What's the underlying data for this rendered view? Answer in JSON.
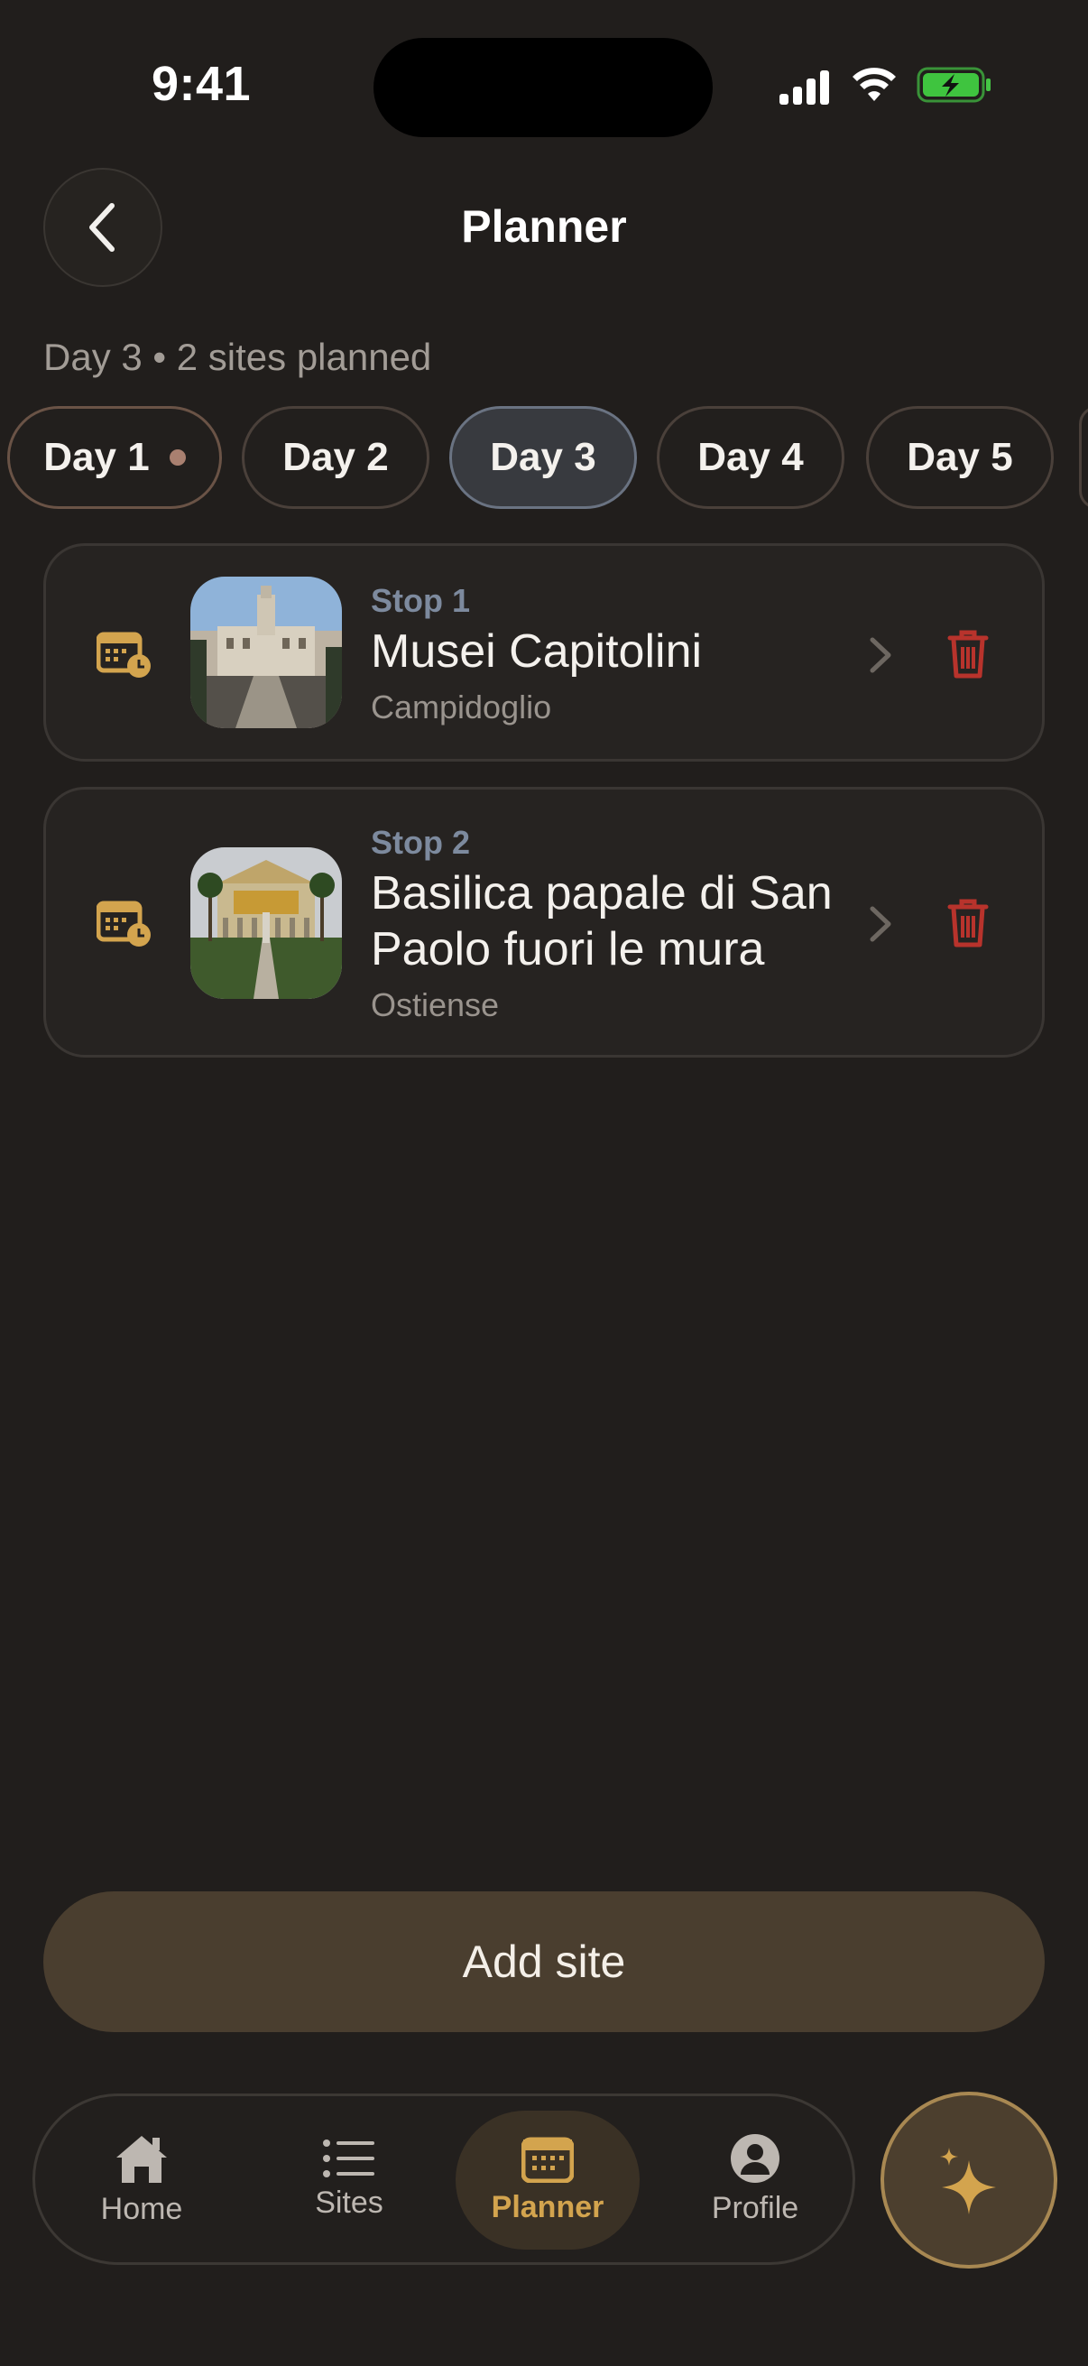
{
  "status_bar": {
    "time": "9:41"
  },
  "header": {
    "title": "Planner"
  },
  "summary": {
    "text": "Day 3 • 2 sites planned"
  },
  "day_tabs": [
    {
      "label": "Day 1",
      "has_dot": true
    },
    {
      "label": "Day 2"
    },
    {
      "label": "Day 3",
      "active": true
    },
    {
      "label": "Day 4"
    },
    {
      "label": "Day 5"
    }
  ],
  "stops": [
    {
      "label": "Stop 1",
      "name_lines": [
        "Musei Capitolini"
      ],
      "area": "Campidoglio"
    },
    {
      "label": "Stop 2",
      "name_lines": [
        "Basilica papale di San",
        "Paolo fuori le mura"
      ],
      "area": "Ostiense"
    }
  ],
  "actions": {
    "add_site": "Add site"
  },
  "nav": {
    "items": [
      {
        "label": "Home",
        "icon": "home-icon"
      },
      {
        "label": "Sites",
        "icon": "list-icon"
      },
      {
        "label": "Planner",
        "icon": "calendar-icon",
        "active": true
      },
      {
        "label": "Profile",
        "icon": "person-icon"
      }
    ],
    "fab_icon": "sparkle-icon"
  },
  "colors": {
    "background": "#211e1c",
    "accent_gold": "#d3a44e",
    "delete_red": "#b8332c",
    "stop_label": "#7d8a9e"
  }
}
